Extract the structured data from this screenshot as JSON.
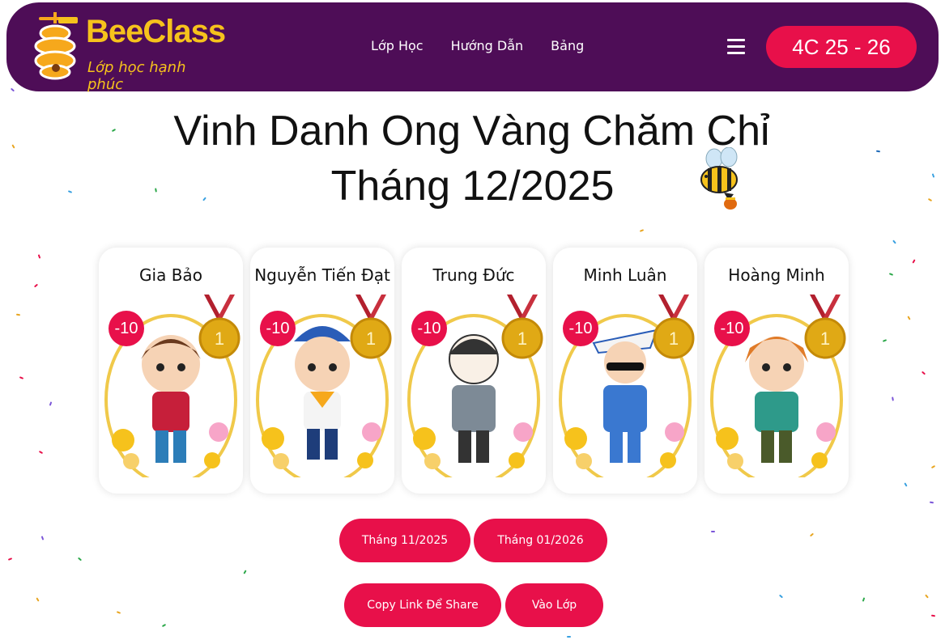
{
  "brand": {
    "name": "BeeClass",
    "tagline": "Lớp học hạnh phúc"
  },
  "nav": {
    "links": [
      "Lớp Học",
      "Hướng Dẫn",
      "Bảng"
    ]
  },
  "class_badge": "4C 25 - 26",
  "title": {
    "line1": "Vinh Danh Ong Vàng Chăm Chỉ",
    "line2": "Tháng 12/2025"
  },
  "cards": [
    {
      "name": "Gia Bảo",
      "score": "-10"
    },
    {
      "name": "Nguyễn Tiến Đạt",
      "score": "-10"
    },
    {
      "name": "Trung Đức",
      "score": "-10"
    },
    {
      "name": "Minh Luân",
      "score": "-10"
    },
    {
      "name": "Hoàng Minh",
      "score": "-10"
    }
  ],
  "buttons": {
    "prev_month": "Tháng 11/2025",
    "next_month": "Tháng 01/2026",
    "copy_link": "Copy Link Để Share",
    "join_class": "Vào Lớp"
  },
  "colors": {
    "navbar": "#4e0d57",
    "accent": "#e8104a",
    "brand_yellow": "#f6c21c"
  }
}
